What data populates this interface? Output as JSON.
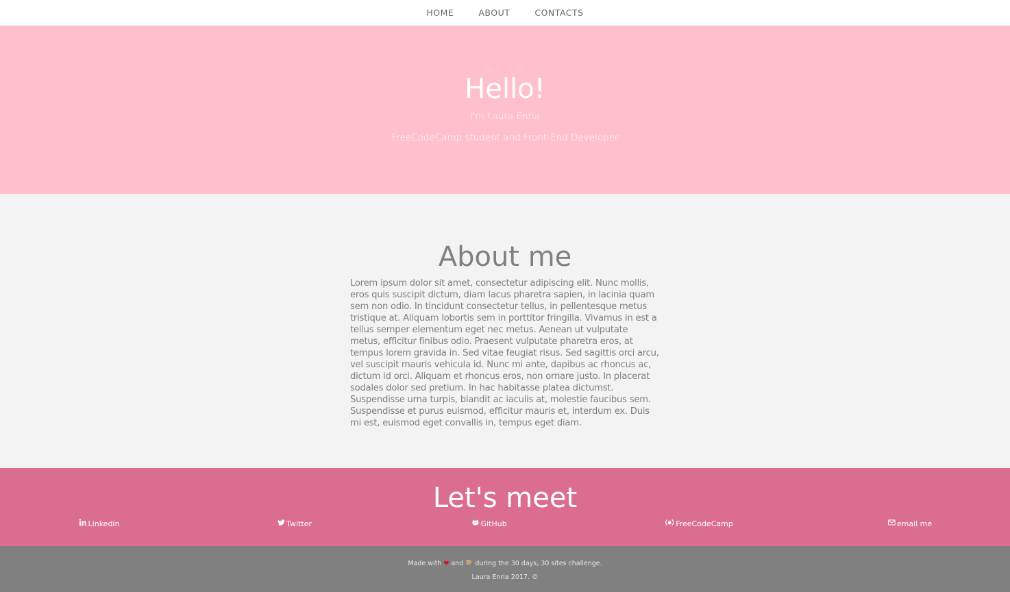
{
  "nav": {
    "items": [
      {
        "label": "HOME"
      },
      {
        "label": "ABOUT"
      },
      {
        "label": "CONTACTS"
      }
    ]
  },
  "hero": {
    "title": "Hello!",
    "subtitle": "I'm Laura Enria",
    "tagline": "FreeCodeCamp student and Front-End Developer"
  },
  "about": {
    "title": "About me",
    "text": "Lorem ipsum dolor sit amet, consectetur adipiscing elit. Nunc mollis, eros quis suscipit dictum, diam lacus pharetra sapien, in lacinia quam sem non odio. In tincidunt consectetur tellus, in pellentesque metus tristique at. Aliquam lobortis sem in porttitor fringilla. Vivamus in est a tellus semper elementum eget nec metus. Aenean ut vulputate metus, efficitur finibus odio. Praesent vulputate pharetra eros, at tempus lorem gravida in. Sed vitae feugiat risus. Sed sagittis orci arcu, vel suscipit mauris vehicula id. Nunc mi ante, dapibus ac rhoncus ac, dictum id orci. Aliquam et rhoncus eros, non ornare justo. In placerat sodales dolor sed pretium. In hac habitasse platea dictumst. Suspendisse urna turpis, blandit ac iaculis at, molestie faucibus sem. Suspendisse et purus euismod, efficitur mauris et, interdum ex. Duis mi est, euismod eget convallis in, tempus eget diam."
  },
  "meet": {
    "title": "Let's meet",
    "links": [
      {
        "label": "Linkedin",
        "icon": "linkedin-icon"
      },
      {
        "label": "Twitter",
        "icon": "twitter-icon"
      },
      {
        "label": "GitHub",
        "icon": "github-icon"
      },
      {
        "label": "FreeCodeCamp",
        "icon": "freecodecamp-icon"
      },
      {
        "label": "email me",
        "icon": "envelope-icon"
      }
    ]
  },
  "footer": {
    "made_with": "Made with",
    "and": "and",
    "rest": "during the 30 days, 30 sites challenge.",
    "copyright": "Laura Enria 2017. ©",
    "heart_icon": "heart-icon",
    "coffee_icon": "coffee-icon"
  },
  "colors": {
    "hero_bg": "#ffc0cb",
    "about_bg": "#f3f3f3",
    "meet_bg": "#db6e90",
    "footer_bg": "#808080"
  }
}
